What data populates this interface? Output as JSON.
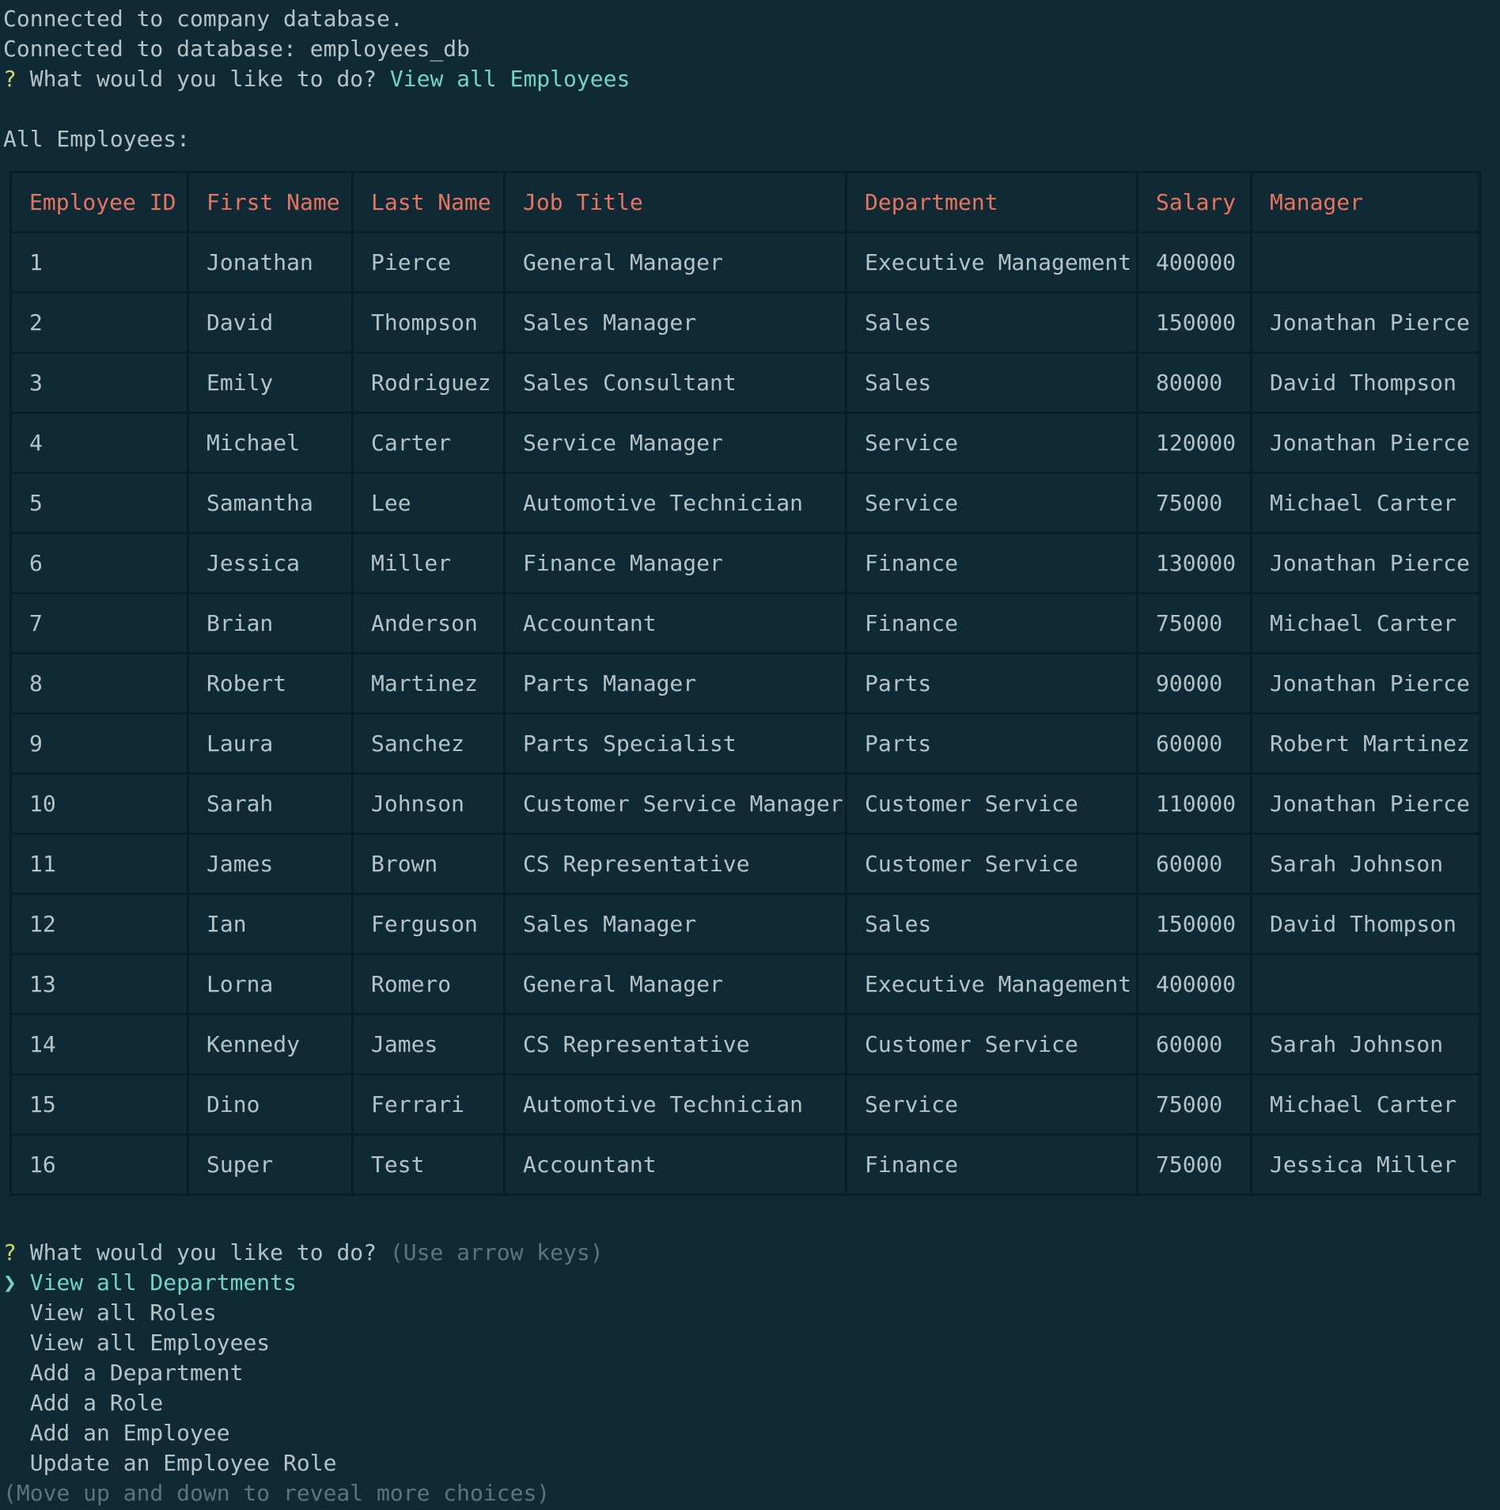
{
  "header": {
    "line1": "Connected to company database.",
    "line2": "Connected to database: employees_db",
    "prompt_mark": "?",
    "prompt_question": "What would you like to do?",
    "prompt_answer": "View all Employees",
    "section_title": "All Employees:"
  },
  "table": {
    "columns": [
      "Employee ID",
      "First Name",
      "Last Name",
      "Job Title",
      "Department",
      "Salary",
      "Manager"
    ],
    "rows": [
      [
        "1",
        "Jonathan",
        "Pierce",
        "General Manager",
        "Executive Management",
        "400000",
        ""
      ],
      [
        "2",
        "David",
        "Thompson",
        "Sales Manager",
        "Sales",
        "150000",
        "Jonathan Pierce"
      ],
      [
        "3",
        "Emily",
        "Rodriguez",
        "Sales Consultant",
        "Sales",
        "80000",
        "David Thompson"
      ],
      [
        "4",
        "Michael",
        "Carter",
        "Service Manager",
        "Service",
        "120000",
        "Jonathan Pierce"
      ],
      [
        "5",
        "Samantha",
        "Lee",
        "Automotive Technician",
        "Service",
        "75000",
        "Michael Carter"
      ],
      [
        "6",
        "Jessica",
        "Miller",
        "Finance Manager",
        "Finance",
        "130000",
        "Jonathan Pierce"
      ],
      [
        "7",
        "Brian",
        "Anderson",
        "Accountant",
        "Finance",
        "75000",
        "Michael Carter"
      ],
      [
        "8",
        "Robert",
        "Martinez",
        "Parts Manager",
        "Parts",
        "90000",
        "Jonathan Pierce"
      ],
      [
        "9",
        "Laura",
        "Sanchez",
        "Parts Specialist",
        "Parts",
        "60000",
        "Robert Martinez"
      ],
      [
        "10",
        "Sarah",
        "Johnson",
        "Customer Service Manager",
        "Customer Service",
        "110000",
        "Jonathan Pierce"
      ],
      [
        "11",
        "James",
        "Brown",
        "CS Representative",
        "Customer Service",
        "60000",
        "Sarah Johnson"
      ],
      [
        "12",
        "Ian",
        "Ferguson",
        "Sales Manager",
        "Sales",
        "150000",
        "David Thompson"
      ],
      [
        "13",
        "Lorna",
        "Romero",
        "General Manager",
        "Executive Management",
        "400000",
        ""
      ],
      [
        "14",
        "Kennedy",
        "James",
        "CS Representative",
        "Customer Service",
        "60000",
        "Sarah Johnson"
      ],
      [
        "15",
        "Dino",
        "Ferrari",
        "Automotive Technician",
        "Service",
        "75000",
        "Michael Carter"
      ],
      [
        "16",
        "Super",
        "Test",
        "Accountant",
        "Finance",
        "75000",
        "Jessica Miller"
      ]
    ]
  },
  "prompt2": {
    "mark": "?",
    "question": "What would you like to do?",
    "hint": "(Use arrow keys)",
    "cursor": "❯",
    "choices": [
      "View all Departments",
      "View all Roles",
      "View all Employees",
      "Add a Department",
      "Add a Role",
      "Add an Employee",
      "Update an Employee Role"
    ],
    "more_hint": "(Move up and down to reveal more choices)"
  },
  "colors": {
    "background": "#102a35",
    "text": "#b3c3c6",
    "header_text": "#e8735f",
    "answer_text": "#72d3c8",
    "prompt_mark": "#cbd56a",
    "hint_text": "#5e7479",
    "table_border": "#0a1e27"
  }
}
